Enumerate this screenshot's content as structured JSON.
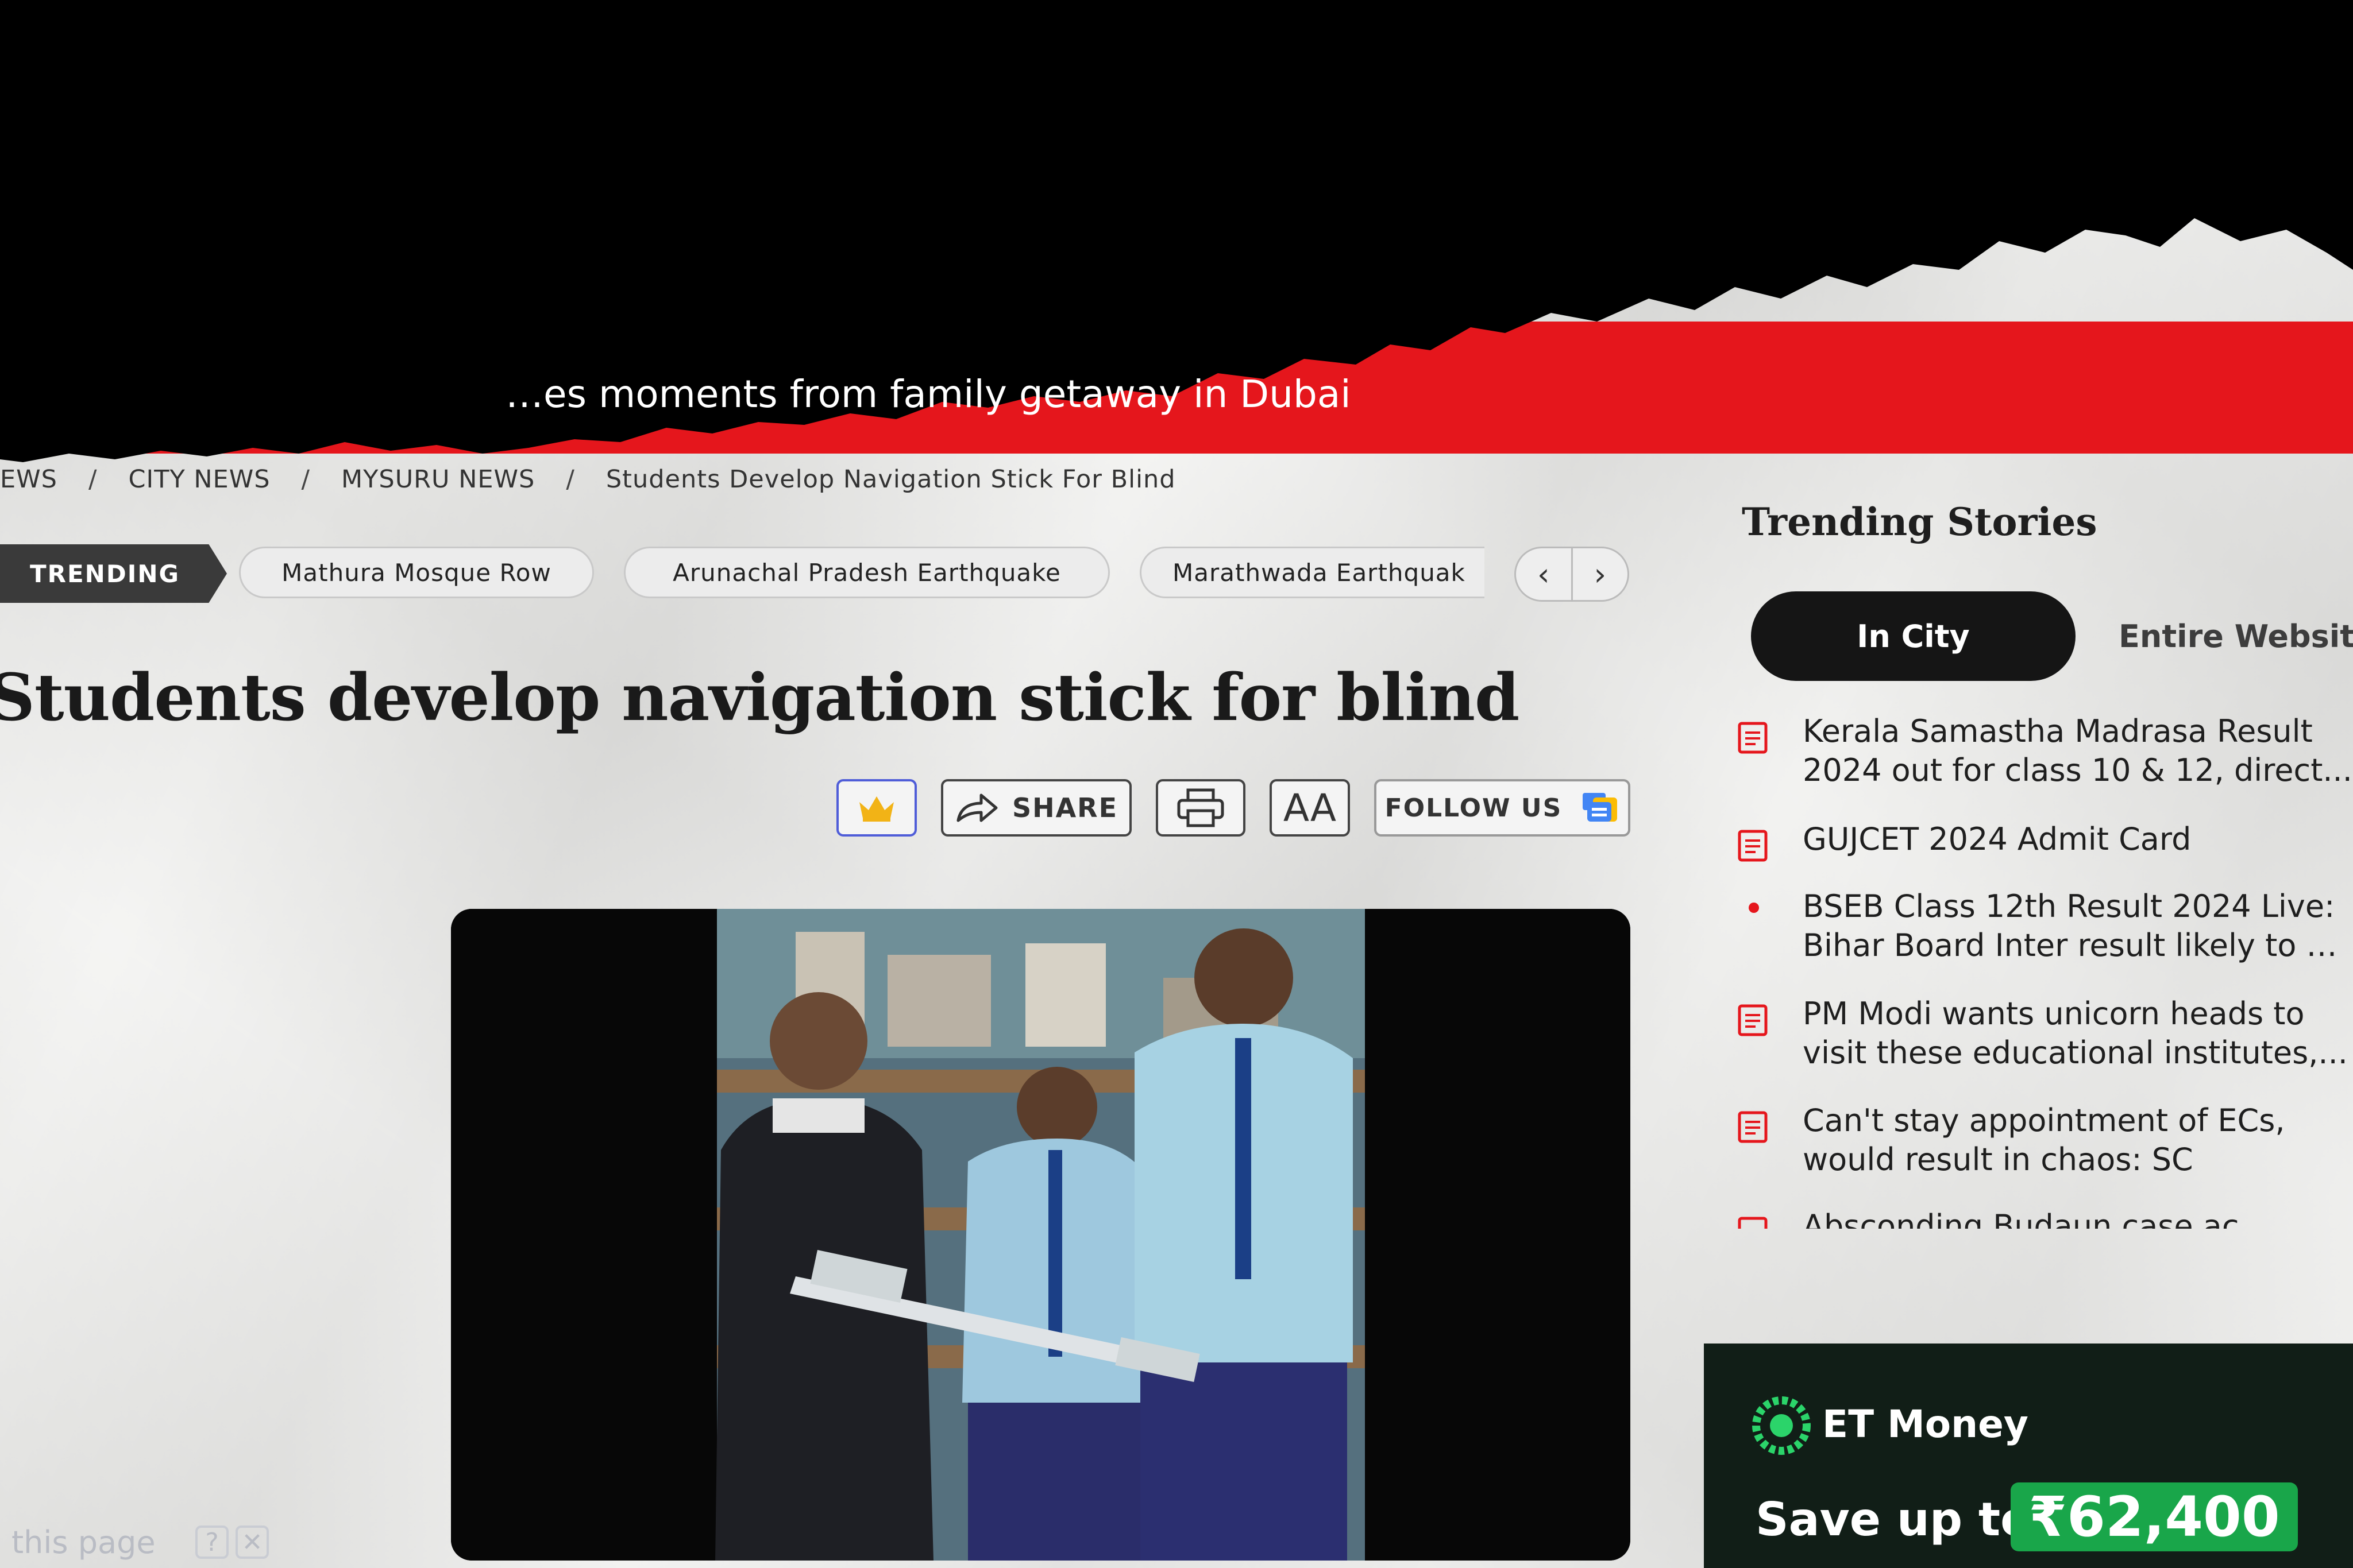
{
  "ticker": {
    "headline_fragment": "…es moments from family getaway in Dubai"
  },
  "breadcrumb": [
    "EWS",
    "CITY NEWS",
    "MYSURU NEWS",
    "Students Develop Navigation Stick For Blind"
  ],
  "trending": {
    "label": "TRENDING",
    "chips": [
      "Mathura Mosque Row",
      "Arunachal Pradesh Earthquake",
      "Marathwada Earthquak"
    ],
    "prev_icon": "chevron-left-icon",
    "next_icon": "chevron-right-icon"
  },
  "article": {
    "headline": "Students develop navigation stick for blind",
    "actions": {
      "share_label": "SHARE",
      "font_size_label": "AA",
      "follow_label": "FOLLOW US"
    }
  },
  "sidebar": {
    "title": "Trending Stories",
    "tabs": [
      "In City",
      "Entire Website"
    ],
    "stories": [
      {
        "lines": [
          "Kerala Samastha Madrasa Result",
          "2024 out for class 10 & 12, direct..."
        ],
        "icon": "article-icon"
      },
      {
        "lines": [
          "GUJCET 2024 Admit Card"
        ],
        "icon": "article-icon"
      },
      {
        "lines": [
          "BSEB Class 12th Result 2024 Live:",
          "Bihar Board Inter result likely to b..."
        ],
        "icon": "live-dot-icon"
      },
      {
        "lines": [
          "PM Modi wants unicorn heads to",
          "visit these educational institutes,..."
        ],
        "icon": "article-icon"
      },
      {
        "lines": [
          "Can't stay appointment of ECs,",
          "would result in chaos: SC"
        ],
        "icon": "article-icon"
      },
      {
        "lines": [
          "Absconding Budaun case ac..."
        ],
        "icon": "article-icon"
      }
    ]
  },
  "ad": {
    "brand": "ET Money",
    "save_text": "Save up to",
    "amount": "₹62,400"
  },
  "translate_bar": {
    "text": "this page",
    "help": "?",
    "close": "✕"
  },
  "colors": {
    "ticker_red": "#e5161c",
    "ad_green": "#19a64a",
    "prime_border": "#4f5dd8"
  }
}
